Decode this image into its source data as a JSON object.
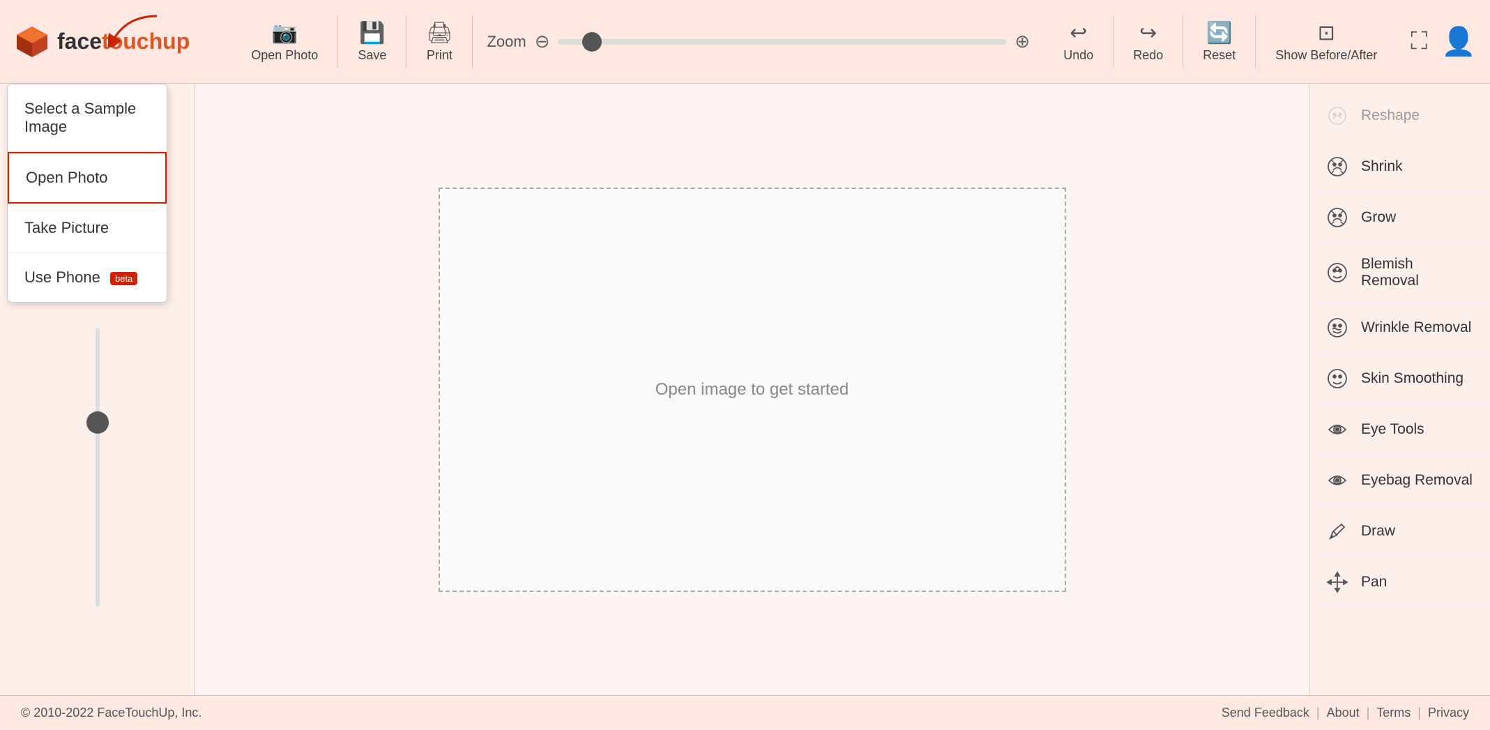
{
  "app": {
    "title": "FaceTouchUp",
    "logo_text_start": "face",
    "logo_text_end": "touchup"
  },
  "header": {
    "toolbar": {
      "open_photo": "Open Photo",
      "save": "Save",
      "print": "Print",
      "zoom_label": "Zoom",
      "undo": "Undo",
      "redo": "Redo",
      "reset": "Reset",
      "show_before_after": "Show Before/After"
    }
  },
  "dropdown": {
    "items": [
      {
        "id": "select-sample",
        "label": "Select a Sample Image",
        "active": false
      },
      {
        "id": "open-photo",
        "label": "Open Photo",
        "active": true
      },
      {
        "id": "take-picture",
        "label": "Take Picture",
        "active": false
      },
      {
        "id": "use-phone",
        "label": "Use Phone",
        "beta": true,
        "active": false
      }
    ]
  },
  "canvas": {
    "placeholder": "Open image to get started"
  },
  "tools": [
    {
      "id": "reshape",
      "label": "Reshape",
      "icon": "face_retouching_natural",
      "disabled": true
    },
    {
      "id": "shrink",
      "label": "Shrink",
      "icon": "compress",
      "disabled": false
    },
    {
      "id": "grow",
      "label": "Grow",
      "icon": "expand",
      "disabled": false
    },
    {
      "id": "blemish-removal",
      "label": "Blemish Removal",
      "icon": "healing",
      "disabled": false
    },
    {
      "id": "wrinkle-removal",
      "label": "Wrinkle Removal",
      "icon": "auto_fix_high",
      "disabled": false
    },
    {
      "id": "skin-smoothing",
      "label": "Skin Smoothing",
      "icon": "blur_on",
      "disabled": false
    },
    {
      "id": "eye-tools",
      "label": "Eye Tools",
      "icon": "visibility",
      "disabled": false
    },
    {
      "id": "eyebag-removal",
      "label": "Eyebag Removal",
      "icon": "remove_red_eye",
      "disabled": false
    },
    {
      "id": "draw",
      "label": "Draw",
      "icon": "brush",
      "disabled": false
    },
    {
      "id": "pan",
      "label": "Pan",
      "icon": "open_with",
      "disabled": false
    }
  ],
  "footer": {
    "copyright": "© 2010-2022 FaceTouchUp, Inc.",
    "links": [
      "Send Feedback",
      "About",
      "Terms",
      "Privacy"
    ]
  }
}
